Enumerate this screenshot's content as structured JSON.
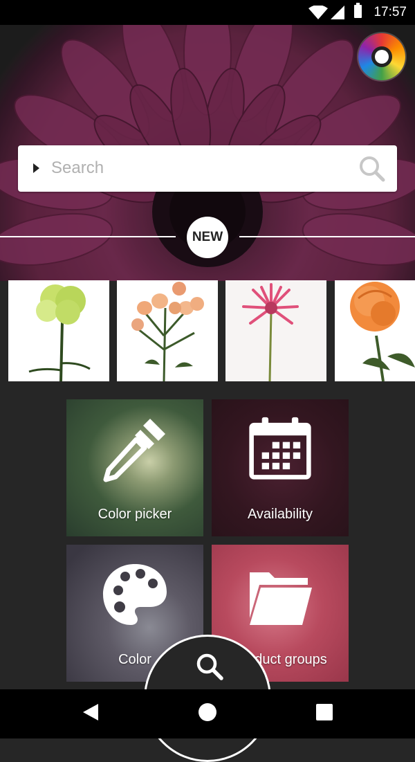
{
  "status_bar": {
    "time": "17:57",
    "icons": [
      "wifi-icon",
      "signal-icon",
      "battery-icon"
    ]
  },
  "hero": {
    "profile_icon": "flower-logo-icon"
  },
  "search": {
    "placeholder": "Search",
    "icon": "search-icon"
  },
  "new_badge": {
    "label": "NEW"
  },
  "new_products": [
    {
      "name": "green-carnation"
    },
    {
      "name": "peach-spray-rose"
    },
    {
      "name": "pink-gerbera"
    },
    {
      "name": "orange-rose"
    }
  ],
  "tiles": {
    "color_picker": {
      "label": "Color picker",
      "icon": "eyedropper-icon"
    },
    "availability": {
      "label": "Availability",
      "icon": "calendar-icon"
    },
    "color": {
      "label": "Color",
      "icon": "palette-icon"
    },
    "product_groups": {
      "label": "Product groups",
      "icon": "folder-icon"
    }
  },
  "fab": {
    "icon": "search-icon"
  },
  "navbar": {
    "icons": [
      "back-icon",
      "home-icon",
      "recents-icon"
    ]
  },
  "colors": {
    "background": "#262626",
    "hero_petal": "#7c2f57",
    "white": "#ffffff"
  }
}
